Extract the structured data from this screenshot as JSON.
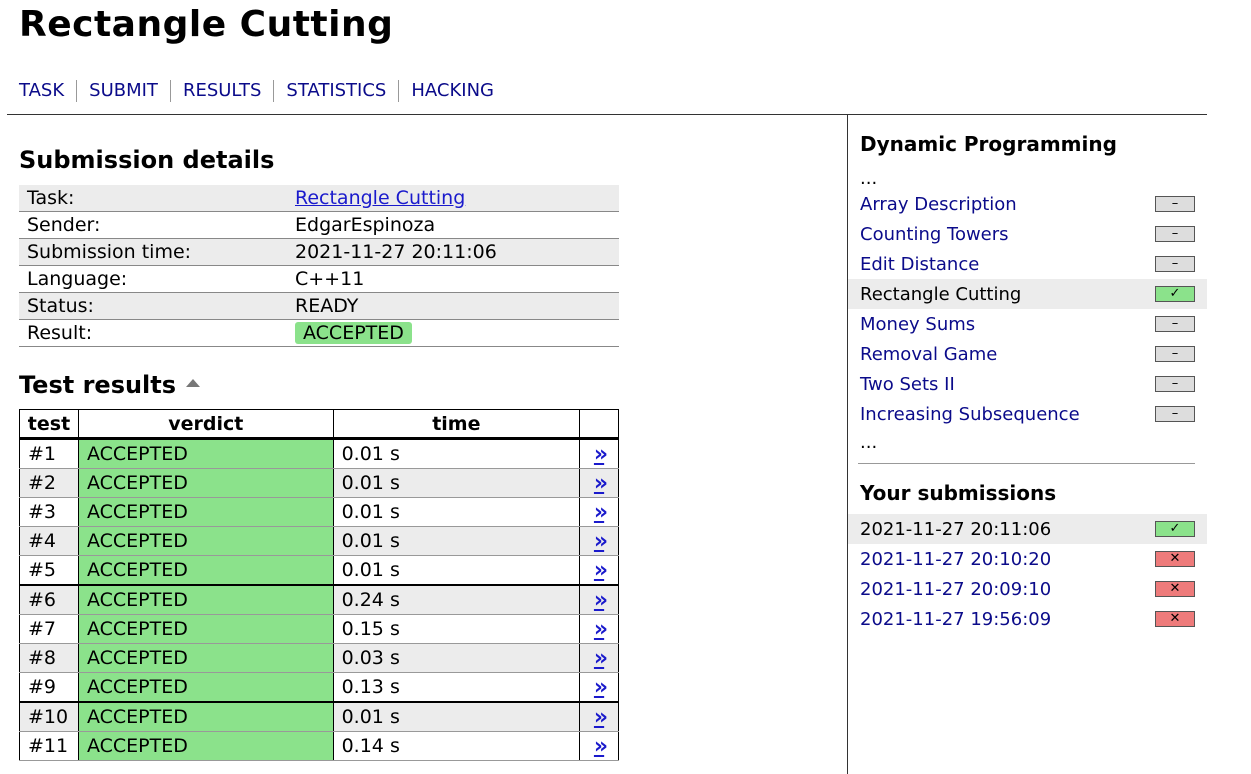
{
  "page_title": "Rectangle Cutting",
  "nav": [
    "TASK",
    "SUBMIT",
    "RESULTS",
    "STATISTICS",
    "HACKING"
  ],
  "details": {
    "heading": "Submission details",
    "rows": [
      {
        "label": "Task:",
        "value": "Rectangle Cutting"
      },
      {
        "label": "Sender:",
        "value": "EdgarEspinoza"
      },
      {
        "label": "Submission time:",
        "value": "2021-11-27 20:11:06"
      },
      {
        "label": "Language:",
        "value": "C++11"
      },
      {
        "label": "Status:",
        "value": "READY"
      },
      {
        "label": "Result:",
        "value": "ACCEPTED"
      }
    ]
  },
  "tests": {
    "heading": "Test results",
    "headers": [
      "test",
      "verdict",
      "time",
      ""
    ],
    "link_glyph": "»",
    "rows": [
      {
        "test": "#1",
        "verdict": "ACCEPTED",
        "time": "0.01 s"
      },
      {
        "test": "#2",
        "verdict": "ACCEPTED",
        "time": "0.01 s"
      },
      {
        "test": "#3",
        "verdict": "ACCEPTED",
        "time": "0.01 s"
      },
      {
        "test": "#4",
        "verdict": "ACCEPTED",
        "time": "0.01 s"
      },
      {
        "test": "#5",
        "verdict": "ACCEPTED",
        "time": "0.01 s"
      },
      {
        "test": "#6",
        "verdict": "ACCEPTED",
        "time": "0.24 s"
      },
      {
        "test": "#7",
        "verdict": "ACCEPTED",
        "time": "0.15 s"
      },
      {
        "test": "#8",
        "verdict": "ACCEPTED",
        "time": "0.03 s"
      },
      {
        "test": "#9",
        "verdict": "ACCEPTED",
        "time": "0.13 s"
      },
      {
        "test": "#10",
        "verdict": "ACCEPTED",
        "time": "0.01 s"
      },
      {
        "test": "#11",
        "verdict": "ACCEPTED",
        "time": "0.14 s"
      }
    ]
  },
  "sidebar": {
    "section_title": "Dynamic Programming",
    "ellipsis": "...",
    "tasks": [
      {
        "name": "Array Description",
        "status": "none",
        "current": false
      },
      {
        "name": "Counting Towers",
        "status": "none",
        "current": false
      },
      {
        "name": "Edit Distance",
        "status": "none",
        "current": false
      },
      {
        "name": "Rectangle Cutting",
        "status": "ok",
        "current": true
      },
      {
        "name": "Money Sums",
        "status": "none",
        "current": false
      },
      {
        "name": "Removal Game",
        "status": "none",
        "current": false
      },
      {
        "name": "Two Sets II",
        "status": "none",
        "current": false
      },
      {
        "name": "Increasing Subsequence",
        "status": "none",
        "current": false
      }
    ],
    "submissions_title": "Your submissions",
    "submissions": [
      {
        "time": "2021-11-27 20:11:06",
        "status": "ok",
        "current": true
      },
      {
        "time": "2021-11-27 20:10:20",
        "status": "fail",
        "current": false
      },
      {
        "time": "2021-11-27 20:09:10",
        "status": "fail",
        "current": false
      },
      {
        "time": "2021-11-27 19:56:09",
        "status": "fail",
        "current": false
      }
    ],
    "glyphs": {
      "none": "–",
      "ok": "✓",
      "fail": "✕"
    }
  },
  "colors": {
    "accepted": "#8be28b",
    "failed": "#ee7b7b",
    "link": "#0b0b8a"
  }
}
